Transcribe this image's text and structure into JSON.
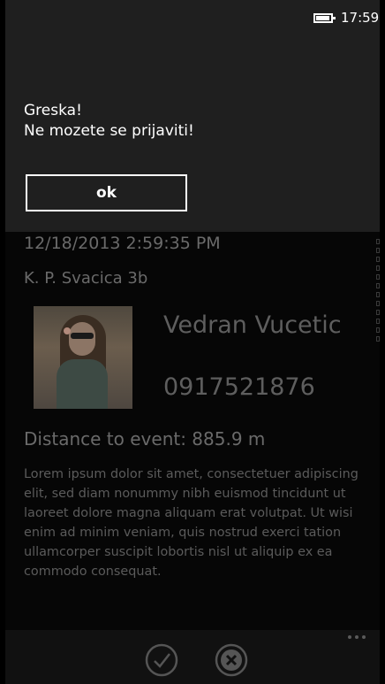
{
  "status_bar": {
    "time": "17:59"
  },
  "dialog": {
    "title": "Greska!",
    "message": "Ne mozete se prijaviti!",
    "ok_label": "ok"
  },
  "event": {
    "date": "12/18/2013 2:59:35 PM",
    "address": "K. P. Svacica 3b",
    "name": "Vedran Vucetic",
    "phone": "0917521876",
    "distance": "Distance to event: 885.9 m",
    "description": "Lorem ipsum dolor sit amet, consectetuer adipiscing elit, sed diam nonummy nibh euismod tincidunt ut laoreet dolore magna aliquam erat volutpat. Ut wisi enim ad minim veniam, quis nostrud exerci tation ullamcorper suscipit lobortis nisl ut aliquip ex ea commodo consequat."
  },
  "app_bar": {
    "icons": [
      "check-icon",
      "close-icon"
    ]
  }
}
